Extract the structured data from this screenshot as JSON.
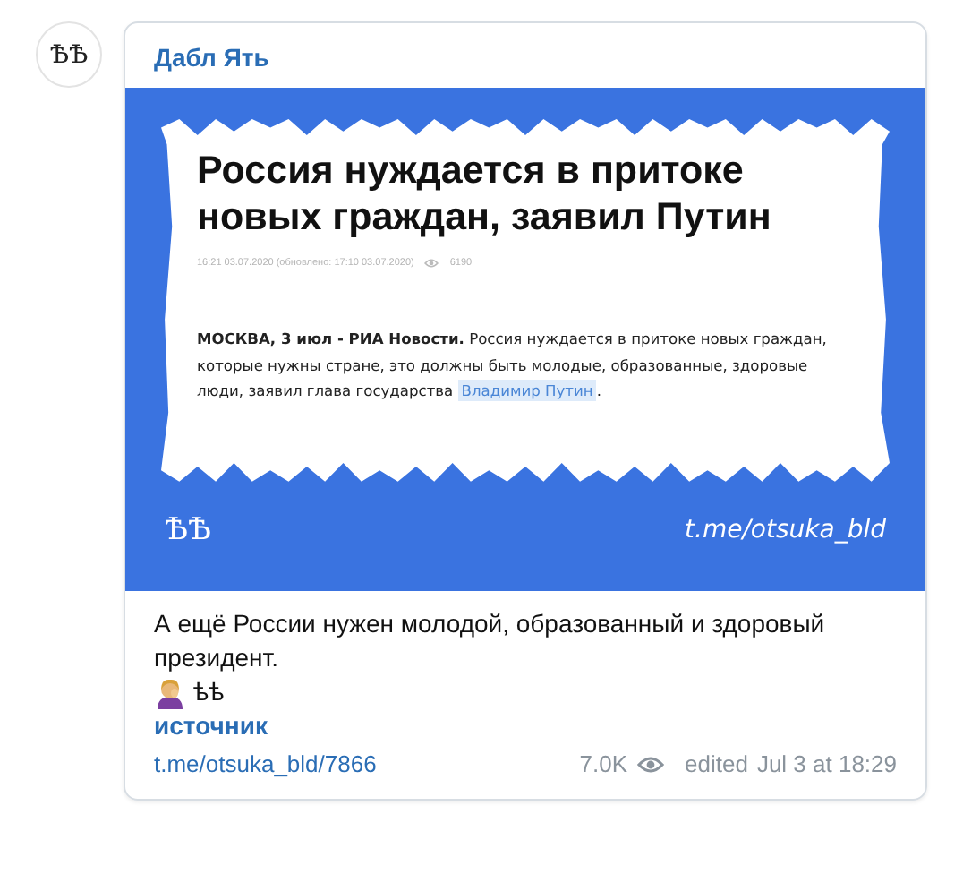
{
  "channel": {
    "avatar_text": "ѢѢ",
    "name": "Дабл Ять"
  },
  "article_image": {
    "headline": "Россия нуждается в притоке новых граждан, заявил Путин",
    "meta": "16:21 03.07.2020 (обновлено: 17:10 03.07.2020)",
    "views": "6190",
    "lead": "**МОСКВА, 3 июл - РИА Новости.** Россия нуждается в притоке новых граждан, которые нужны стране, это должны быть молодые, образованные, здоровые люди, заявил глава государства",
    "link": "Владимир Путин",
    "end": ".",
    "logo": "ѢѢ",
    "handle": "t.me/otsuka_bld"
  },
  "caption": "А ещё России нужен молодой, образованный и здоровый президент.",
  "signature": "ѣѣ",
  "source_link": "источник",
  "footer": {
    "link": "t.me/otsuka_bld/7866",
    "views": "7.0K",
    "edited": "edited",
    "date": "Jul 3 at 18:29"
  }
}
